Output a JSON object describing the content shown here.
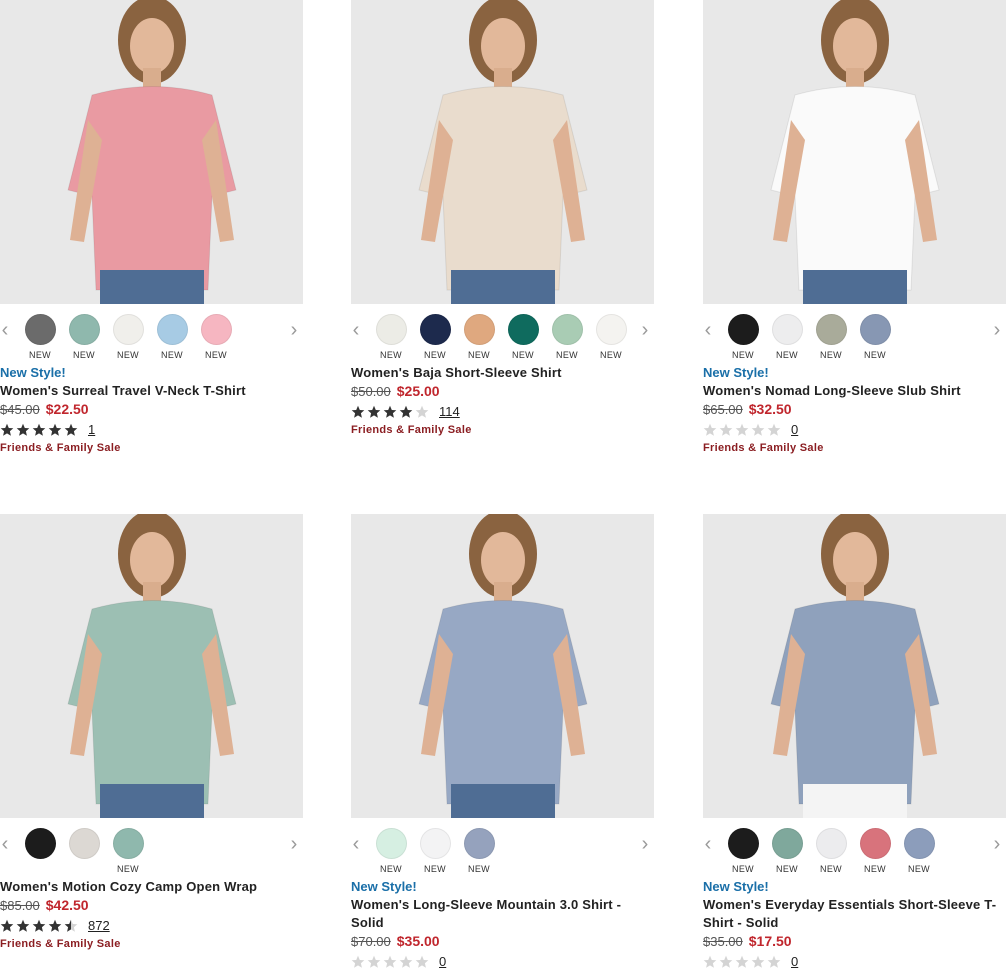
{
  "labels": {
    "new_tag": "NEW",
    "prev_arrow": "‹",
    "next_arrow": "›"
  },
  "products": [
    {
      "badge": "New Style!",
      "title": "Women's Surreal Travel V-Neck T-Shirt",
      "was": "$45.00",
      "now": "$22.50",
      "rating": 5,
      "review_count": "1",
      "promo": "Friends & Family Sale",
      "swatches": [
        {
          "color": "#6b6b6b",
          "tag": "NEW"
        },
        {
          "color": "#8fb8ad",
          "tag": "NEW"
        },
        {
          "color": "#f0efeb",
          "tag": "NEW"
        },
        {
          "color": "#a7cbe4",
          "tag": "NEW"
        },
        {
          "color": "#f6b6c1",
          "tag": "NEW"
        }
      ],
      "garment_color": "#e99aa2"
    },
    {
      "badge": "",
      "title": "Women's Baja Short-Sleeve Shirt",
      "was": "$50.00",
      "now": "$25.00",
      "rating": 4,
      "review_count": "114",
      "promo": "Friends & Family Sale",
      "swatches": [
        {
          "color": "#ececE6",
          "tag": "NEW"
        },
        {
          "color": "#1d2a4d",
          "tag": "NEW"
        },
        {
          "color": "#dfa87f",
          "tag": "NEW"
        },
        {
          "color": "#0f6b5e",
          "tag": "NEW"
        },
        {
          "color": "#a9ccb4",
          "tag": "NEW"
        },
        {
          "color": "#f4f3f0",
          "tag": "NEW"
        }
      ],
      "garment_color": "#e9dccd"
    },
    {
      "badge": "New Style!",
      "title": "Women's Nomad Long-Sleeve Slub Shirt",
      "was": "$65.00",
      "now": "$32.50",
      "rating": 0,
      "review_count": "0",
      "promo": "Friends & Family Sale",
      "swatches": [
        {
          "color": "#1c1c1c",
          "tag": "NEW"
        },
        {
          "color": "#ededee",
          "tag": "NEW"
        },
        {
          "color": "#a9ab9a",
          "tag": "NEW"
        },
        {
          "color": "#8797b3",
          "tag": "NEW"
        }
      ],
      "garment_color": "#fafafa"
    },
    {
      "badge": "",
      "title": "Women's Motion Cozy Camp Open Wrap",
      "was": "$85.00",
      "now": "$42.50",
      "rating": 4.5,
      "review_count": "872",
      "promo": "Friends & Family Sale",
      "swatches": [
        {
          "color": "#1c1c1c",
          "tag": ""
        },
        {
          "color": "#dcd8d3",
          "tag": ""
        },
        {
          "color": "#8fb8ad",
          "tag": "NEW"
        }
      ],
      "garment_color": "#9cbfb3"
    },
    {
      "badge": "New Style!",
      "title": "Women's Long-Sleeve Mountain 3.0 Shirt - Solid",
      "was": "$70.00",
      "now": "$35.00",
      "rating": 0,
      "review_count": "0",
      "promo": "",
      "swatches": [
        {
          "color": "#d6efe2",
          "tag": "NEW"
        },
        {
          "color": "#f3f3f4",
          "tag": "NEW"
        },
        {
          "color": "#95a2bd",
          "tag": "NEW"
        }
      ],
      "garment_color": "#97a8c4"
    },
    {
      "badge": "New Style!",
      "title": "Women's Everyday Essentials Short-Sleeve T-Shirt - Solid",
      "was": "$35.00",
      "now": "$17.50",
      "rating": 0,
      "review_count": "0",
      "promo": "",
      "swatches": [
        {
          "color": "#1c1c1c",
          "tag": "NEW"
        },
        {
          "color": "#7fa89c",
          "tag": "NEW"
        },
        {
          "color": "#ececee",
          "tag": "NEW"
        },
        {
          "color": "#d8737c",
          "tag": "NEW"
        },
        {
          "color": "#8c9dbb",
          "tag": "NEW"
        }
      ],
      "garment_color": "#8fa1bc"
    }
  ]
}
